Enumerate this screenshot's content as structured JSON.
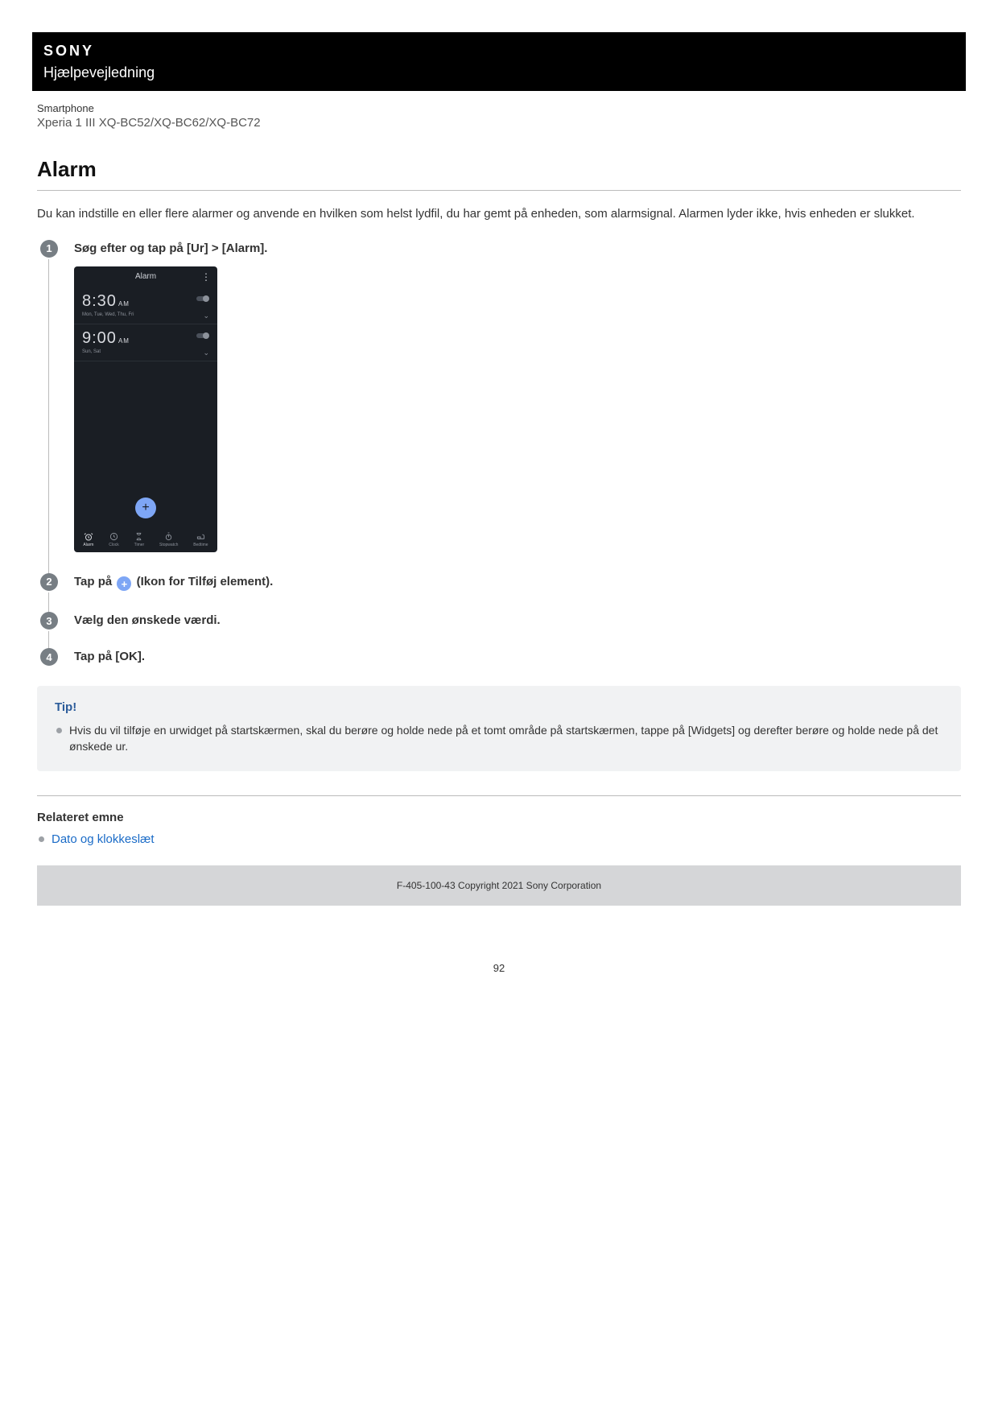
{
  "header": {
    "brand": "SONY",
    "guide": "Hjælpevejledning"
  },
  "device": {
    "category": "Smartphone",
    "model": "Xperia 1 III XQ-BC52/XQ-BC62/XQ-BC72"
  },
  "page": {
    "title": "Alarm",
    "intro": "Du kan indstille en eller flere alarmer og anvende en hvilken som helst lydfil, du har gemt på enheden, som alarmsignal. Alarmen lyder ikke, hvis enheden er slukket."
  },
  "steps": [
    {
      "num": "1",
      "title": "Søg efter og tap på [Ur] > [Alarm]."
    },
    {
      "num": "2",
      "title_pre": "Tap på ",
      "title_post": " (Ikon for Tilføj element).",
      "icon": "+"
    },
    {
      "num": "3",
      "title": "Vælg den ønskede værdi."
    },
    {
      "num": "4",
      "title": "Tap på [OK]."
    }
  ],
  "phone": {
    "topTitle": "Alarm",
    "alarms": [
      {
        "time": "8:30",
        "ampm": "AM",
        "days": "Mon, Tue, Wed, Thu, Fri"
      },
      {
        "time": "9:00",
        "ampm": "AM",
        "days": "Sun, Sat"
      }
    ],
    "nav": [
      {
        "label": "Alarm",
        "active": true
      },
      {
        "label": "Clock"
      },
      {
        "label": "Timer"
      },
      {
        "label": "Stopwatch"
      },
      {
        "label": "Bedtime"
      }
    ],
    "fab": "+"
  },
  "tip": {
    "title": "Tip!",
    "items": [
      "Hvis du vil tilføje en urwidget på startskærmen, skal du berøre og holde nede på et tomt område på startskærmen, tappe på [Widgets] og derefter berøre og holde nede på det ønskede ur."
    ]
  },
  "related": {
    "title": "Relateret emne",
    "items": [
      "Dato og klokkeslæt"
    ]
  },
  "footer": {
    "copyright": "F-405-100-43 Copyright 2021 Sony Corporation"
  },
  "pageNumber": "92"
}
